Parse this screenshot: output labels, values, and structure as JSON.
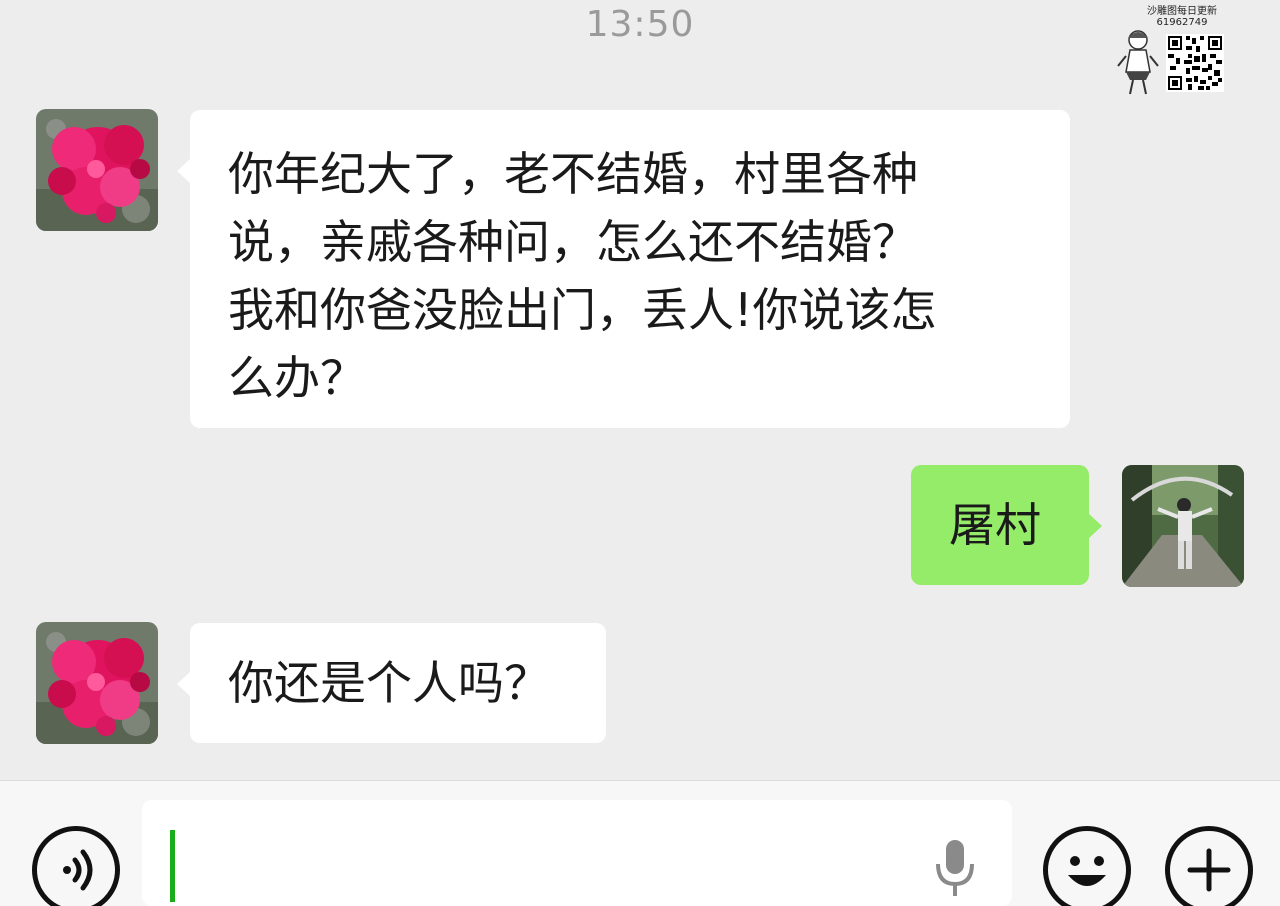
{
  "status": {
    "time": "13:50"
  },
  "watermark": {
    "text_line1": "沙雕图每日更新",
    "text_line2": "61962749"
  },
  "messages": [
    {
      "direction": "incoming",
      "text": "你年纪大了，老不结婚，村里各种说，亲戚各种问，怎么还不结婚？我和你爸没脸出门，丢人!你说该怎么办？",
      "lines": [
        "你年纪大了，老不结婚，村里各种",
        "说，亲戚各种问，怎么还不结婚？",
        "我和你爸没脸出门，丢人!你说该怎",
        "么办？"
      ]
    },
    {
      "direction": "outgoing",
      "text": "屠村"
    },
    {
      "direction": "incoming",
      "text": "你还是个人吗？"
    }
  ],
  "input": {
    "value": ""
  },
  "icons": {
    "voice_toggle": "voice-toggle-icon",
    "microphone": "microphone-icon",
    "emoji": "emoji-icon",
    "more": "plus-icon"
  },
  "colors": {
    "background": "#ededed",
    "incoming_bubble": "#ffffff",
    "outgoing_bubble": "#95ec69",
    "caret": "#1aad19"
  }
}
